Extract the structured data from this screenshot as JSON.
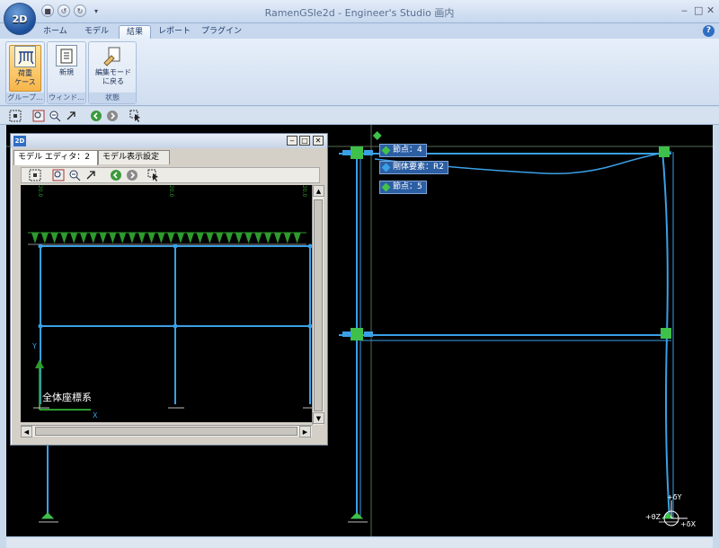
{
  "app": {
    "title": "RamenGSIe2d - Engineer's Studio 画内",
    "orb_label": "2D"
  },
  "window_controls": [
    "‒",
    "□",
    "✕"
  ],
  "help": "?",
  "ribbon_tabs": [
    "ホーム",
    "モデル",
    "結果",
    "レポート",
    "プラグイン"
  ],
  "active_tab_index": 2,
  "ribbon_groups": [
    {
      "label": "グループ...",
      "buttons": [
        {
          "label1": "荷重",
          "label2": "ケース",
          "active": true
        }
      ]
    },
    {
      "label": "ウィンド...",
      "buttons": [
        {
          "label1": "新規",
          "label2": "",
          "active": false
        }
      ]
    },
    {
      "label": "状態",
      "buttons": [
        {
          "label1": "編集モード",
          "label2": "に戻る",
          "active": false
        }
      ]
    }
  ],
  "main_canvas": {
    "node_tags": [
      "節点：4",
      "剛体要素：R2",
      "節点：5"
    ]
  },
  "editor": {
    "window_icon": "2D",
    "tabs": [
      "モデル エディタ：2",
      "モデル表示設定"
    ],
    "active_tab_index": 0,
    "axis_label": "全体座標系",
    "axis_x": "X",
    "axis_y": "Y",
    "load_label": "20.0"
  },
  "origin_labels": {
    "dy": "+δY",
    "dx": "+δX",
    "theta": "+θZ"
  },
  "colors": {
    "frame": "#3aa0e6",
    "load": "#2e9b2e",
    "node": "#3ec04a",
    "tag_bg": "#2c5ea3",
    "ribbon_active": "#f8b54a"
  }
}
